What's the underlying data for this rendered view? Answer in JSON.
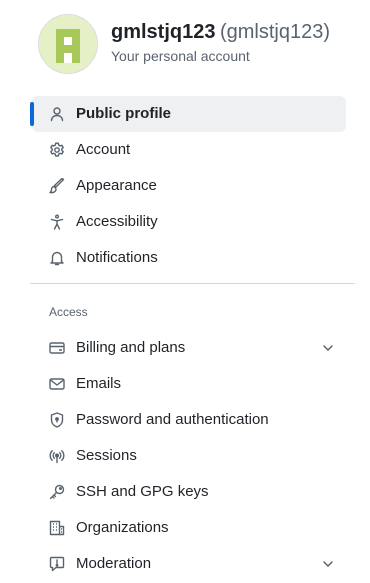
{
  "header": {
    "display_name": "gmlstjq123",
    "login": "(gmlstjq123)",
    "subtitle": "Your personal account",
    "avatar_color": "#e5f0c6"
  },
  "nav": {
    "items": [
      {
        "label": "Public profile",
        "icon": "person-icon",
        "active": true
      },
      {
        "label": "Account",
        "icon": "gear-icon"
      },
      {
        "label": "Appearance",
        "icon": "paintbrush-icon"
      },
      {
        "label": "Accessibility",
        "icon": "accessibility-icon"
      },
      {
        "label": "Notifications",
        "icon": "bell-icon"
      }
    ]
  },
  "access": {
    "heading": "Access",
    "items": [
      {
        "label": "Billing and plans",
        "icon": "credit-card-icon",
        "expandable": true
      },
      {
        "label": "Emails",
        "icon": "mail-icon"
      },
      {
        "label": "Password and authentication",
        "icon": "shield-lock-icon"
      },
      {
        "label": "Sessions",
        "icon": "broadcast-icon"
      },
      {
        "label": "SSH and GPG keys",
        "icon": "key-icon"
      },
      {
        "label": "Organizations",
        "icon": "organization-icon"
      },
      {
        "label": "Moderation",
        "icon": "report-icon",
        "expandable": true
      }
    ]
  },
  "colors": {
    "accent": "#0969da",
    "active_bg": "#eef0f2",
    "text": "#1f2328",
    "muted": "#59636e"
  }
}
